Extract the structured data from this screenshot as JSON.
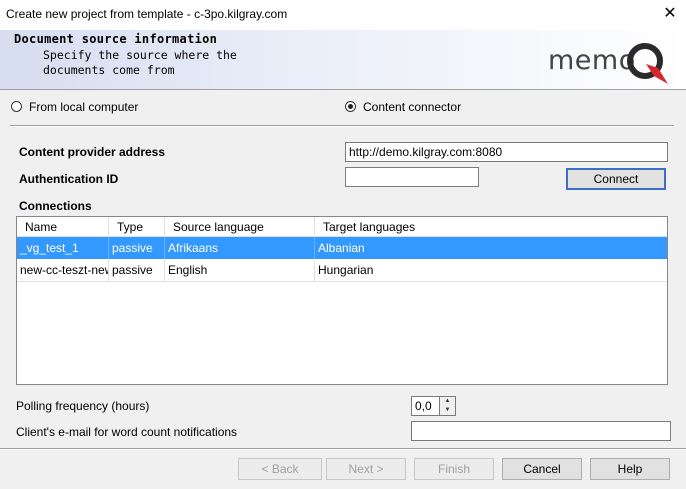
{
  "window": {
    "title": "Create new project from template - c-3po.kilgray.com",
    "close_glyph": "✕"
  },
  "header": {
    "title": "Document source information",
    "subtitle_line1": "Specify the source where the",
    "subtitle_line2": "documents come from",
    "logo_text": "memo",
    "logo_letter": "Q"
  },
  "source": {
    "local_label": "From local computer",
    "connector_label": "Content connector",
    "selected": "connector"
  },
  "form": {
    "provider_label": "Content provider address",
    "provider_value": "http://demo.kilgray.com:8080",
    "auth_label": "Authentication ID",
    "auth_value": "",
    "connect_label": "Connect",
    "connections_label": "Connections"
  },
  "table": {
    "columns": [
      "Name",
      "Type",
      "Source language",
      "Target languages"
    ],
    "rows": [
      {
        "name": "_vg_test_1",
        "type": "passive",
        "source": "Afrikaans",
        "target": "Albanian",
        "selected": true
      },
      {
        "name": "new-cc-teszt-new",
        "type": "passive",
        "source": "English",
        "target": "Hungarian",
        "selected": false
      }
    ]
  },
  "polling": {
    "label": "Polling frequency (hours)",
    "value": "0,0"
  },
  "email": {
    "label": "Client's e-mail for word count notifications",
    "value": ""
  },
  "buttons": {
    "back": "< Back",
    "next": "Next >",
    "finish": "Finish",
    "cancel": "Cancel",
    "help": "Help"
  }
}
